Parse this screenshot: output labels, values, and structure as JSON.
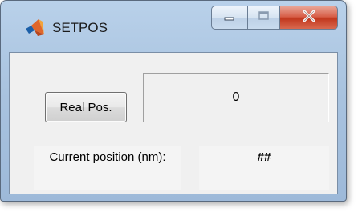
{
  "window": {
    "title": "SETPOS",
    "controls": {
      "minimize_icon": "minimize-icon",
      "maximize_icon": "maximize-icon",
      "close_icon": "close-icon"
    }
  },
  "panel": {
    "real_pos_button": "Real Pos.",
    "value_display": "0",
    "current_position_label": "Current position (nm):",
    "current_position_value": "##"
  },
  "colors": {
    "client_bg": "#f0f0f0",
    "titlebar": "#b9d1ea",
    "close_button": "#c2391f"
  }
}
